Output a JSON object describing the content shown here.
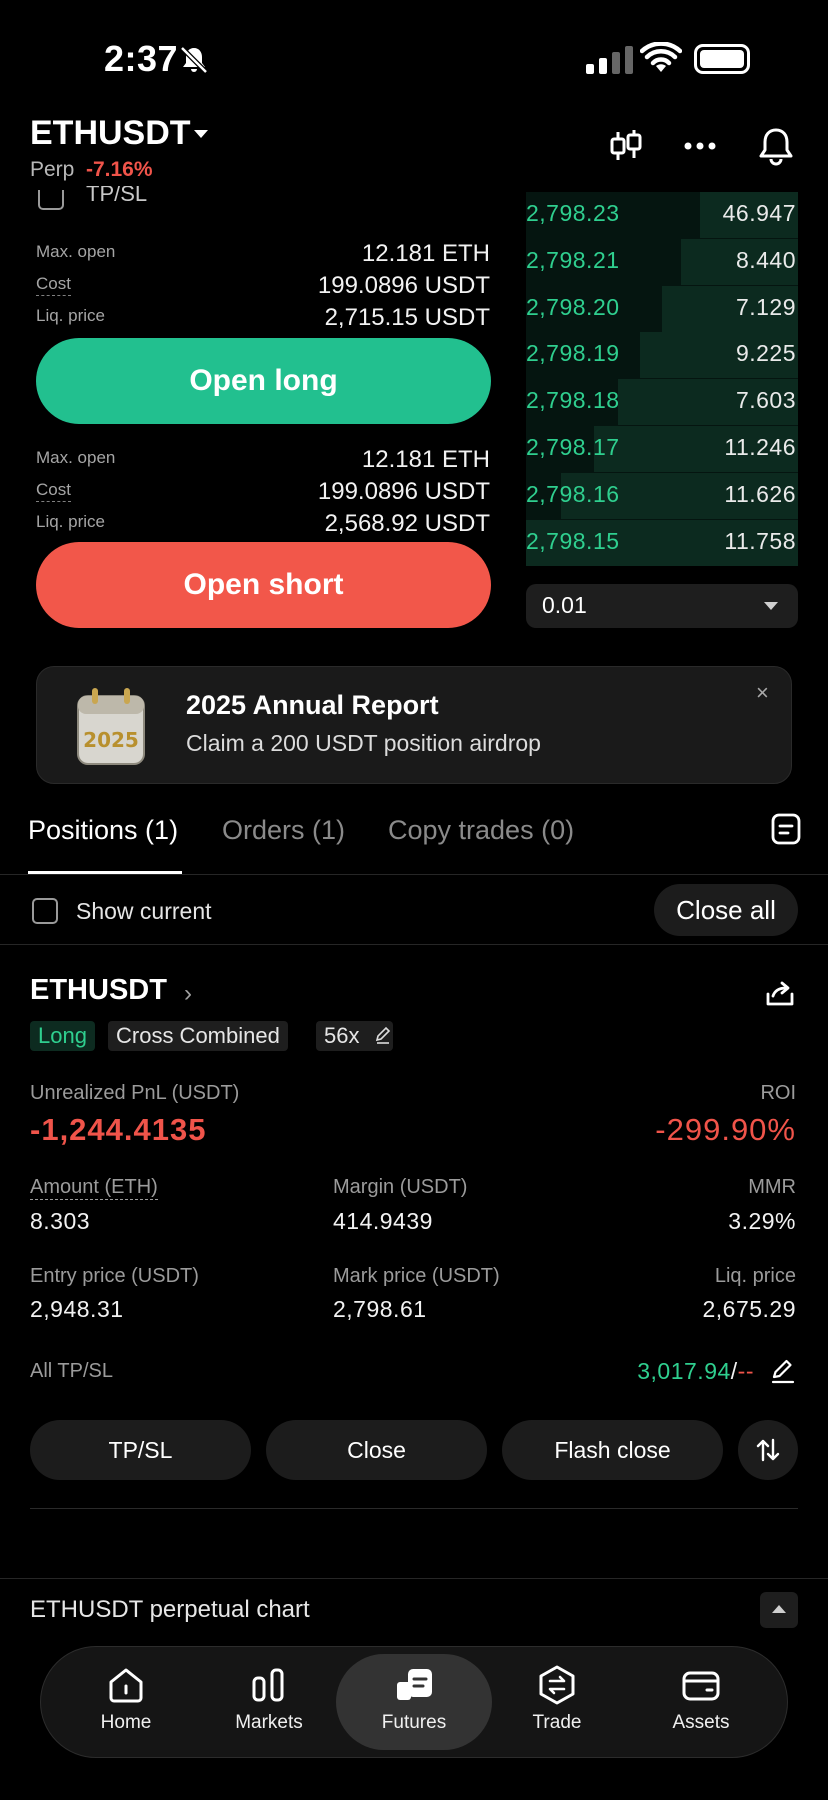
{
  "status_bar": {
    "time": "2:37"
  },
  "header": {
    "pair": "ETHUSDT",
    "contract_type": "Perp",
    "change": "-7.16%"
  },
  "order_form": {
    "tpsl_label": "TP/SL",
    "long": {
      "max_open_label": "Max. open",
      "max_open_value": "12.181 ETH",
      "cost_label": "Cost",
      "cost_value": "199.0896 USDT",
      "liq_label": "Liq. price",
      "liq_value": "2,715.15 USDT",
      "button": "Open long"
    },
    "short": {
      "max_open_label": "Max. open",
      "max_open_value": "12.181 ETH",
      "cost_label": "Cost",
      "cost_value": "199.0896 USDT",
      "liq_label": "Liq. price",
      "liq_value": "2,568.92 USDT",
      "button": "Open short"
    }
  },
  "order_book": {
    "rows": [
      {
        "price": "2,798.23",
        "qty": "46.947",
        "depth": 0.36
      },
      {
        "price": "2,798.21",
        "qty": "8.440",
        "depth": 0.43
      },
      {
        "price": "2,798.20",
        "qty": "7.129",
        "depth": 0.5
      },
      {
        "price": "2,798.19",
        "qty": "9.225",
        "depth": 0.58
      },
      {
        "price": "2,798.18",
        "qty": "7.603",
        "depth": 0.66
      },
      {
        "price": "2,798.17",
        "qty": "11.246",
        "depth": 0.75
      },
      {
        "price": "2,798.16",
        "qty": "11.626",
        "depth": 0.87
      },
      {
        "price": "2,798.15",
        "qty": "11.758",
        "depth": 1.0
      }
    ],
    "step": "0.01"
  },
  "banner": {
    "badge_text": "2025",
    "title": "2025 Annual Report",
    "subtitle": "Claim a 200 USDT position airdrop",
    "close": "×"
  },
  "tabs": [
    {
      "label": "Positions (1)"
    },
    {
      "label": "Orders (1)"
    },
    {
      "label": "Copy trades (0)"
    }
  ],
  "filter": {
    "show_current": "Show current",
    "close_all": "Close all"
  },
  "position": {
    "pair": "ETHUSDT",
    "tags": {
      "side": "Long",
      "mode": "Cross Combined",
      "leverage": "56x"
    },
    "pnl_label": "Unrealized PnL (USDT)",
    "pnl": "-1,244.4135",
    "roi_label": "ROI",
    "roi": "-299.90%",
    "amount_label": "Amount (ETH)",
    "amount": "8.303",
    "margin_label": "Margin (USDT)",
    "margin": "414.9439",
    "mmr_label": "MMR",
    "mmr": "3.29%",
    "entry_label": "Entry price (USDT)",
    "entry": "2,948.31",
    "mark_label": "Mark price (USDT)",
    "mark": "2,798.61",
    "liq_label": "Liq. price",
    "liq": "2,675.29",
    "tpsl_label": "All TP/SL",
    "tp": "3,017.94",
    "sep": "/",
    "sl": "--",
    "actions": {
      "tpsl": "TP/SL",
      "close": "Close",
      "flash": "Flash close"
    }
  },
  "chart_section": {
    "label": "ETHUSDT perpetual chart"
  },
  "nav": [
    {
      "label": "Home"
    },
    {
      "label": "Markets"
    },
    {
      "label": "Futures"
    },
    {
      "label": "Trade"
    },
    {
      "label": "Assets"
    }
  ]
}
